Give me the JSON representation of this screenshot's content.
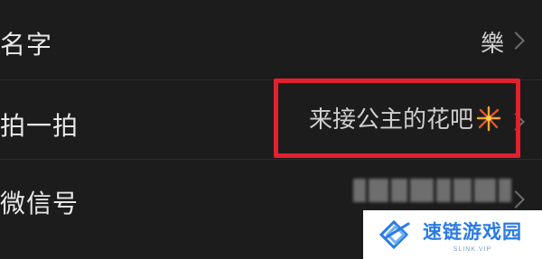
{
  "settings": {
    "rows": [
      {
        "label": "名字",
        "value": "樂"
      },
      {
        "label": "拍一拍",
        "value": "来接公主的花吧"
      },
      {
        "label": "微信号",
        "value": ""
      }
    ]
  },
  "icons": {
    "firework": "firework-emoji-icon",
    "chevron": "chevron-right-icon"
  },
  "colors": {
    "background": "#1c1c1c",
    "highlight": "#e3202e",
    "watermark_brand": "#2a7be4"
  },
  "watermark": {
    "title": "速链游戏园",
    "subtitle": "SLINK.VIP"
  }
}
